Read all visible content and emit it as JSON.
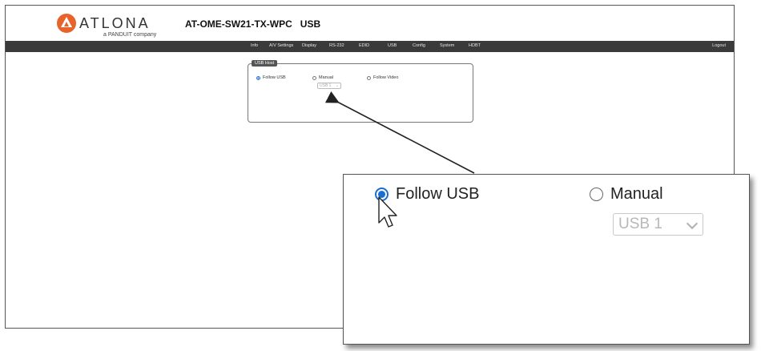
{
  "header": {
    "logo_text": "ATLONA",
    "logo_sub": "a PANDUIT company",
    "page_title": "AT-OME-SW21-TX-WPC   USB"
  },
  "nav": {
    "items": [
      "Info",
      "A/V Settings",
      "Display",
      "RS-232",
      "EDID",
      "USB",
      "Config",
      "System",
      "HDBT"
    ],
    "logout": "Logout"
  },
  "usb_host": {
    "legend": "USB Host",
    "options": [
      "Follow USB",
      "Manual",
      "Follow Video"
    ],
    "selected": "Follow USB",
    "select_value": "USB 1"
  },
  "zoom": {
    "follow_usb": "Follow USB",
    "manual": "Manual",
    "select_value": "USB 1"
  },
  "colors": {
    "navbar": "#3a3a3a",
    "accent": "#1b6fd1",
    "logo": "#e8632b"
  }
}
